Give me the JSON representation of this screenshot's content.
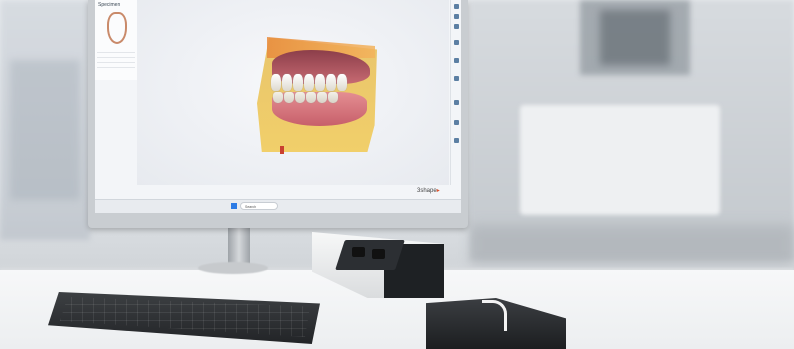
{
  "app": {
    "panel_title": "Specimen",
    "brand": "3shape",
    "brand_mark": "▸",
    "taskbar_search": "Search",
    "status_line": "",
    "tray_time": ""
  },
  "icons": [
    "windows-start-icon",
    "search-icon",
    "jaw-outline-icon"
  ],
  "colors": {
    "brand_accent": "#e0522b",
    "model_stone": "#f1cf6a",
    "gum": "#c76a72"
  }
}
